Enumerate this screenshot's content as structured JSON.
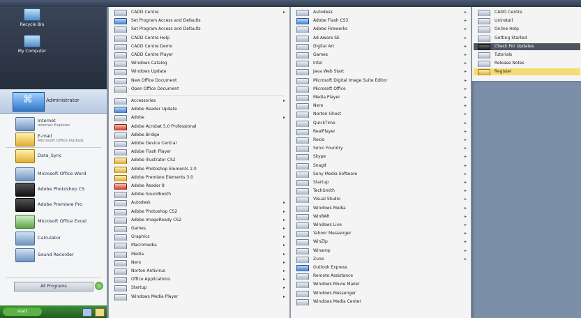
{
  "desktop": {
    "icons": [
      {
        "label": "Recycle Bin",
        "icon": "recycle-bin-icon"
      },
      {
        "label": "My Computer",
        "icon": "computer-icon"
      }
    ]
  },
  "start_menu": {
    "user_name": "Administrator",
    "pinned": [
      {
        "title": "Internet",
        "subtitle": "Internet Explorer",
        "icon": "globe-icon",
        "tone": ""
      },
      {
        "title": "E-mail",
        "subtitle": "Microsoft Office Outlook",
        "icon": "mail-icon",
        "tone": "yellow"
      },
      {
        "title": "Data_Sync",
        "subtitle": "",
        "icon": "folder-icon",
        "tone": "yellow"
      },
      {
        "title": "Microsoft Office Word",
        "subtitle": "",
        "icon": "word-icon",
        "tone": ""
      },
      {
        "title": "Adobe Photoshop CS",
        "subtitle": "",
        "icon": "photoshop-icon",
        "tone": "dark"
      },
      {
        "title": "Adobe Premiere Pro",
        "subtitle": "",
        "icon": "premiere-icon",
        "tone": "dark"
      },
      {
        "title": "Microsoft Office Excel",
        "subtitle": "",
        "icon": "excel-icon",
        "tone": "green"
      },
      {
        "title": "Calculator",
        "subtitle": "",
        "icon": "calculator-icon",
        "tone": ""
      },
      {
        "title": "Sound Recorder",
        "subtitle": "",
        "icon": "microphone-icon",
        "tone": ""
      }
    ],
    "all_programs": "All Programs"
  },
  "taskbar": {
    "start_label": "start"
  },
  "menu_col1": [
    {
      "label": "CADD Centre",
      "tone": "",
      "arrow": true
    },
    {
      "label": "Set Program Access and Defaults",
      "tone": "b",
      "arrow": false
    },
    {
      "label": "Set Program Access and Defaults",
      "tone": "",
      "arrow": false
    },
    {
      "label": "CADD Centre Help",
      "tone": "",
      "arrow": false
    },
    {
      "label": "CADD Centre Demo",
      "tone": "",
      "arrow": false
    },
    {
      "label": "CADD Centre Player",
      "tone": "",
      "arrow": false
    },
    {
      "label": "Windows Catalog",
      "tone": "",
      "arrow": false
    },
    {
      "label": "Windows Update",
      "tone": "",
      "arrow": false
    },
    {
      "label": "New Office Document",
      "tone": "",
      "arrow": false
    },
    {
      "label": "Open Office Document",
      "tone": "",
      "arrow": false
    },
    {
      "sep": true
    },
    {
      "label": "Accessories",
      "tone": "",
      "arrow": true
    },
    {
      "label": "Adobe Reader Update",
      "tone": "b",
      "arrow": false
    },
    {
      "label": "Adobe",
      "tone": "",
      "arrow": true
    },
    {
      "label": "Adobe Acrobat 5.0 Professional",
      "tone": "r",
      "arrow": false
    },
    {
      "label": "Adobe Bridge",
      "tone": "",
      "arrow": false
    },
    {
      "label": "Adobe Device Central",
      "tone": "",
      "arrow": false
    },
    {
      "label": "Adobe Flash Player",
      "tone": "",
      "arrow": false
    },
    {
      "label": "Adobe Illustrator CS2",
      "tone": "y",
      "arrow": false
    },
    {
      "label": "Adobe Photoshop Elements 2.0",
      "tone": "y",
      "arrow": false
    },
    {
      "label": "Adobe Premiere Elements 3.0",
      "tone": "y",
      "arrow": false
    },
    {
      "label": "Adobe Reader 8",
      "tone": "r",
      "arrow": false
    },
    {
      "label": "Adobe Soundbooth",
      "tone": "",
      "arrow": false
    },
    {
      "label": "Autodesk",
      "tone": "",
      "arrow": true
    },
    {
      "label": "Adobe Photoshop CS2",
      "tone": "",
      "arrow": true
    },
    {
      "label": "Adobe ImageReady CS2",
      "tone": "",
      "arrow": true
    },
    {
      "label": "Games",
      "tone": "",
      "arrow": true
    },
    {
      "label": "Graphics",
      "tone": "",
      "arrow": true
    },
    {
      "label": "Macromedia",
      "tone": "",
      "arrow": true
    },
    {
      "label": "Media",
      "tone": "",
      "arrow": true
    },
    {
      "label": "Nero",
      "tone": "",
      "arrow": true
    },
    {
      "label": "Norton Antivirus",
      "tone": "",
      "arrow": true
    },
    {
      "label": "Office Applications",
      "tone": "",
      "arrow": true
    },
    {
      "label": "Startup",
      "tone": "",
      "arrow": true
    },
    {
      "label": "Windows Media Player",
      "tone": "",
      "arrow": true
    }
  ],
  "menu_col2": [
    {
      "label": "Autodesk",
      "tone": "",
      "arrow": true
    },
    {
      "label": "Adobe Flash CS3",
      "tone": "b",
      "arrow": true
    },
    {
      "label": "Adobe Fireworks",
      "tone": "",
      "arrow": true
    },
    {
      "label": "Ad-Aware SE",
      "tone": "",
      "arrow": true
    },
    {
      "label": "Digital Art",
      "tone": "",
      "arrow": true
    },
    {
      "label": "Games",
      "tone": "",
      "arrow": true
    },
    {
      "label": "Intel",
      "tone": "",
      "arrow": true
    },
    {
      "label": "Java Web Start",
      "tone": "",
      "arrow": true
    },
    {
      "label": "Microsoft Digital Image Suite Editor",
      "tone": "",
      "arrow": true
    },
    {
      "label": "Microsoft Office",
      "tone": "",
      "arrow": true
    },
    {
      "label": "Media Player",
      "tone": "",
      "arrow": true
    },
    {
      "label": "Nero",
      "tone": "",
      "arrow": true
    },
    {
      "label": "Norton Ghost",
      "tone": "",
      "arrow": true
    },
    {
      "label": "QuickTime",
      "tone": "",
      "arrow": true
    },
    {
      "label": "RealPlayer",
      "tone": "",
      "arrow": true
    },
    {
      "label": "Roxio",
      "tone": "",
      "arrow": true
    },
    {
      "label": "Sonic Foundry",
      "tone": "",
      "arrow": true
    },
    {
      "label": "Skype",
      "tone": "",
      "arrow": true
    },
    {
      "label": "SnagIt",
      "tone": "",
      "arrow": true
    },
    {
      "label": "Sony Media Software",
      "tone": "",
      "arrow": true
    },
    {
      "label": "Startup",
      "tone": "",
      "arrow": true
    },
    {
      "label": "TechSmith",
      "tone": "",
      "arrow": true
    },
    {
      "label": "Visual Studio",
      "tone": "",
      "arrow": true
    },
    {
      "label": "Windows Media",
      "tone": "",
      "arrow": true
    },
    {
      "label": "WinRAR",
      "tone": "",
      "arrow": true
    },
    {
      "label": "Windows Live",
      "tone": "",
      "arrow": true
    },
    {
      "label": "Yahoo! Messenger",
      "tone": "",
      "arrow": true
    },
    {
      "label": "WinZip",
      "tone": "",
      "arrow": true
    },
    {
      "label": "Winamp",
      "tone": "",
      "arrow": true
    },
    {
      "label": "Zune",
      "tone": "",
      "arrow": true
    },
    {
      "label": "Outlook Express",
      "tone": "b",
      "arrow": false
    },
    {
      "label": "Remote Assistance",
      "tone": "",
      "arrow": false
    },
    {
      "label": "Windows Movie Maker",
      "tone": "",
      "arrow": false
    },
    {
      "label": "Windows Messenger",
      "tone": "",
      "arrow": false
    },
    {
      "label": "Windows Media Center",
      "tone": "",
      "arrow": false
    }
  ],
  "menu_col3": [
    {
      "label": "CADD Centre",
      "tone": "",
      "arrow": false,
      "state": ""
    },
    {
      "label": "Uninstall",
      "tone": "",
      "arrow": false,
      "state": ""
    },
    {
      "label": "Online Help",
      "tone": "",
      "arrow": false,
      "state": ""
    },
    {
      "label": "Getting Started",
      "tone": "",
      "arrow": false,
      "state": ""
    },
    {
      "label": "Check For Updates",
      "tone": "k",
      "arrow": false,
      "state": "hl"
    },
    {
      "label": "Tutorials",
      "tone": "",
      "arrow": false,
      "state": ""
    },
    {
      "label": "Release Notes",
      "tone": "",
      "arrow": false,
      "state": ""
    },
    {
      "label": "Register",
      "tone": "y",
      "arrow": false,
      "state": "hl2"
    }
  ]
}
